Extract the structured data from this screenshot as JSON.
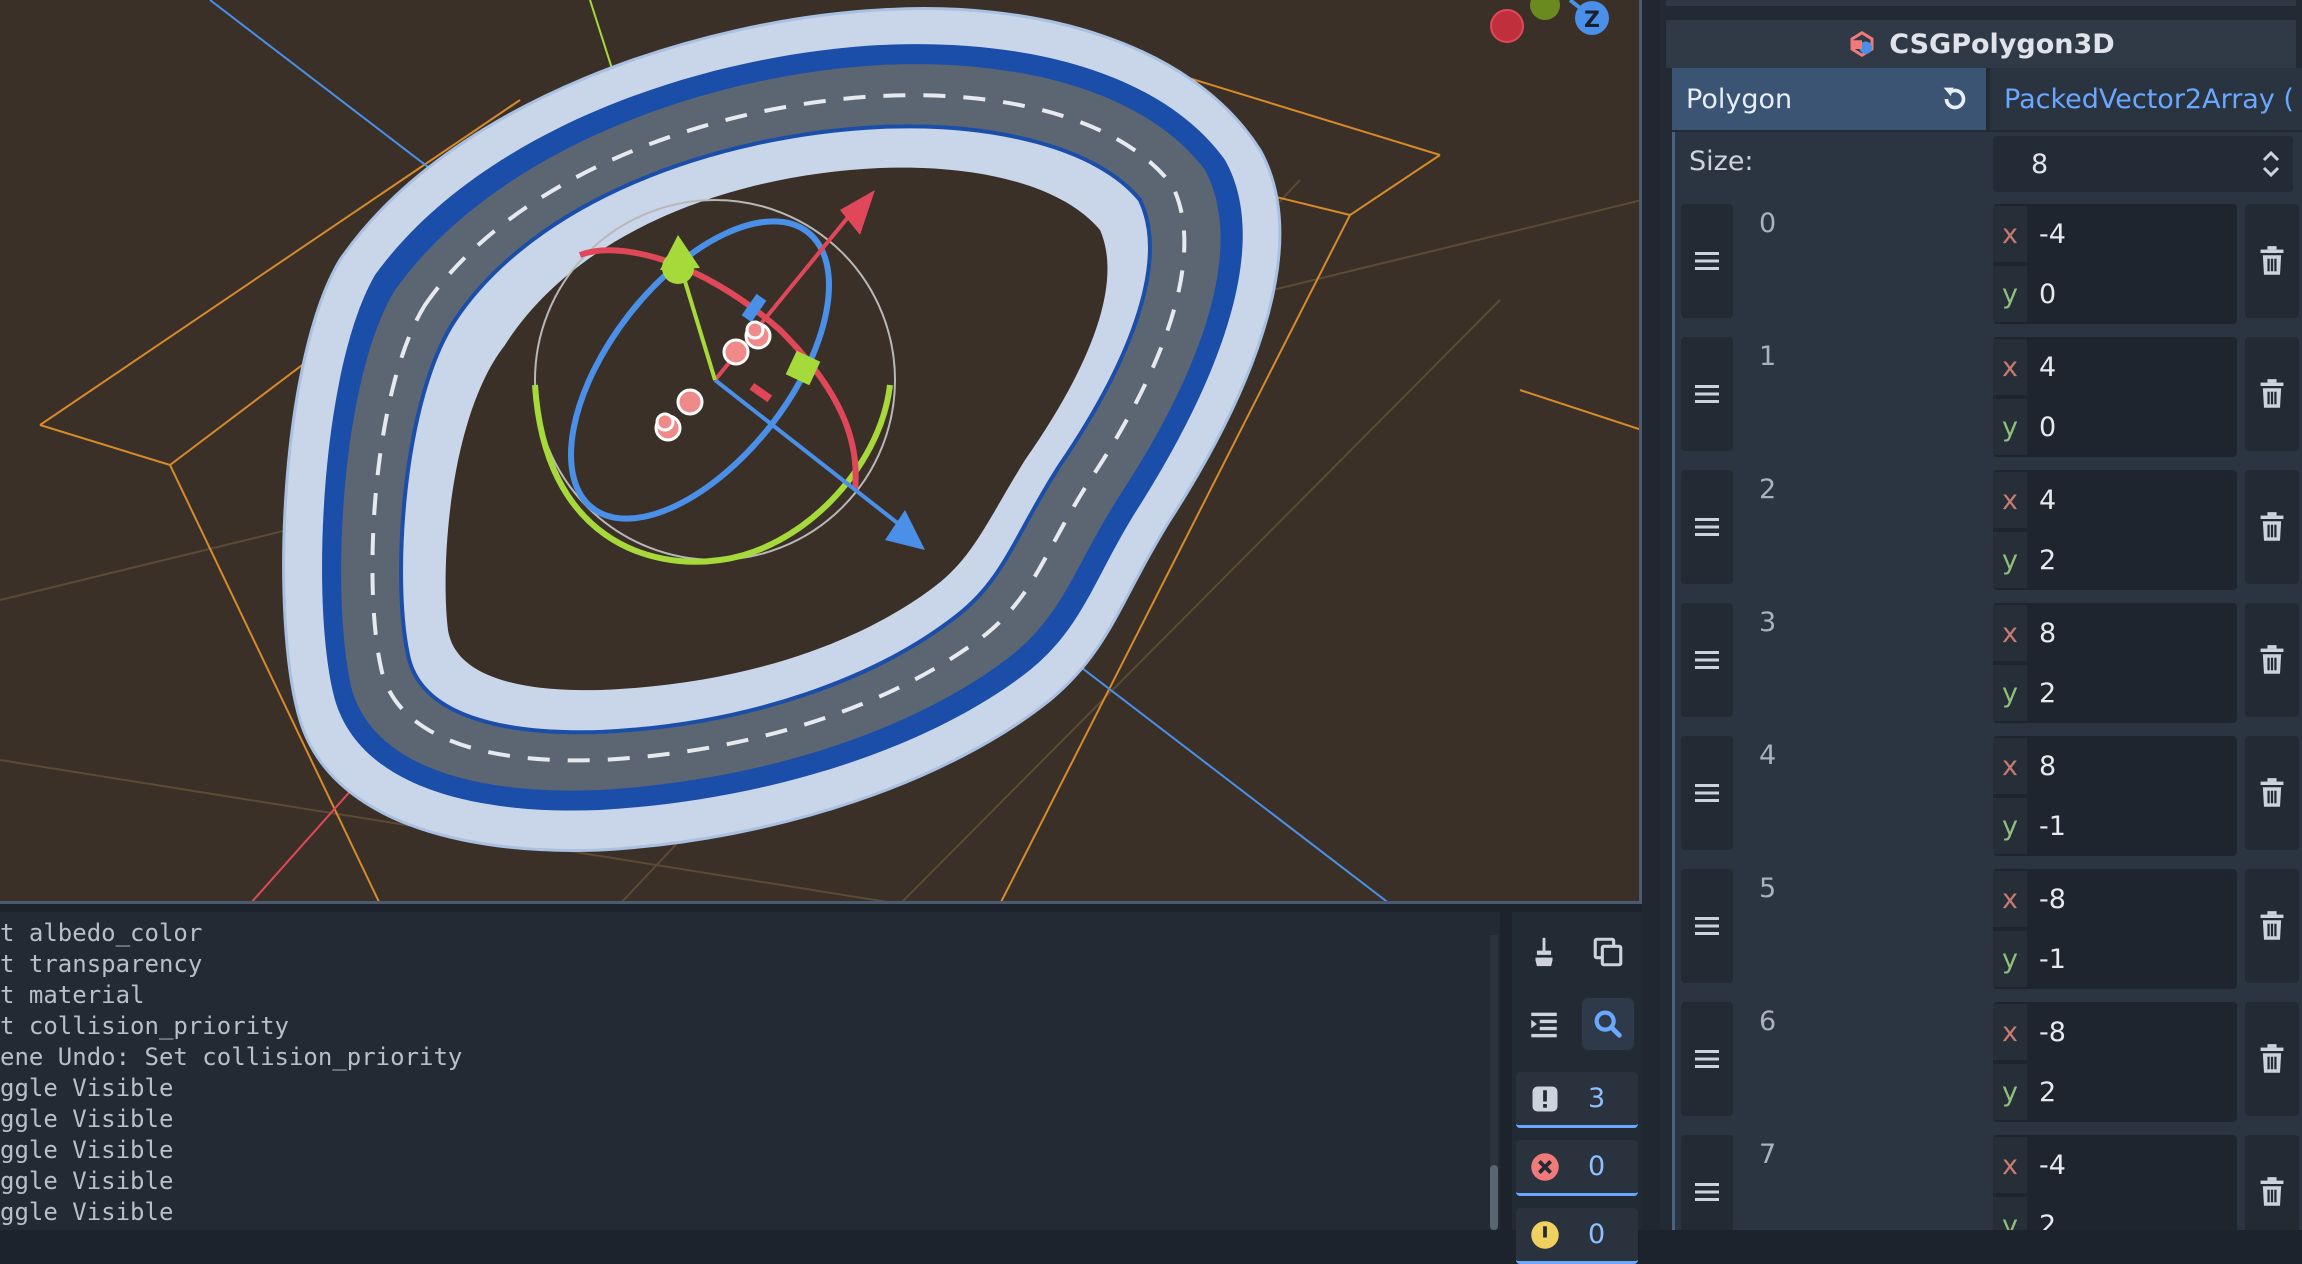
{
  "log": {
    "lines": [
      "t albedo_color",
      "t transparency",
      "t material",
      "t collision_priority",
      "ene Undo: Set collision_priority",
      "ggle Visible",
      "ggle Visible",
      "ggle Visible",
      "ggle Visible",
      "ggle Visible"
    ],
    "tools": [
      {
        "name": "clear-output",
        "icon": "broom-icon"
      },
      {
        "name": "copy-output",
        "icon": "copy-icon"
      },
      {
        "name": "collapse-output",
        "icon": "indent-icon"
      },
      {
        "name": "search-output",
        "icon": "search-icon"
      }
    ],
    "filters": [
      {
        "name": "messages",
        "icon": "message-icon",
        "count": "3"
      },
      {
        "name": "errors",
        "icon": "error-icon",
        "count": "0"
      },
      {
        "name": "warnings",
        "icon": "warning-icon",
        "count": "0"
      }
    ]
  },
  "inspector": {
    "node_title": "CSGPolygon3D",
    "property_label": "Polygon",
    "property_value": "PackedVector2Array (",
    "size_label": "Size:",
    "size_value": "8",
    "x_label": "x",
    "y_label": "y",
    "elements": [
      {
        "index": "0",
        "x": "-4",
        "y": "0"
      },
      {
        "index": "1",
        "x": "4",
        "y": "0"
      },
      {
        "index": "2",
        "x": "4",
        "y": "2"
      },
      {
        "index": "3",
        "x": "8",
        "y": "2"
      },
      {
        "index": "4",
        "x": "8",
        "y": "-1"
      },
      {
        "index": "5",
        "x": "-8",
        "y": "-1"
      },
      {
        "index": "6",
        "x": "-8",
        "y": "2"
      },
      {
        "index": "7",
        "x": "-4",
        "y": "2"
      }
    ]
  },
  "viewport": {
    "axis_gizmo_label": "Z"
  },
  "colors": {
    "accent": "#6aa8ff",
    "x_axis": "#e0485a",
    "y_axis": "#a6d93a",
    "z_axis": "#4a90e8",
    "viewport_bg": "#3a3027"
  }
}
